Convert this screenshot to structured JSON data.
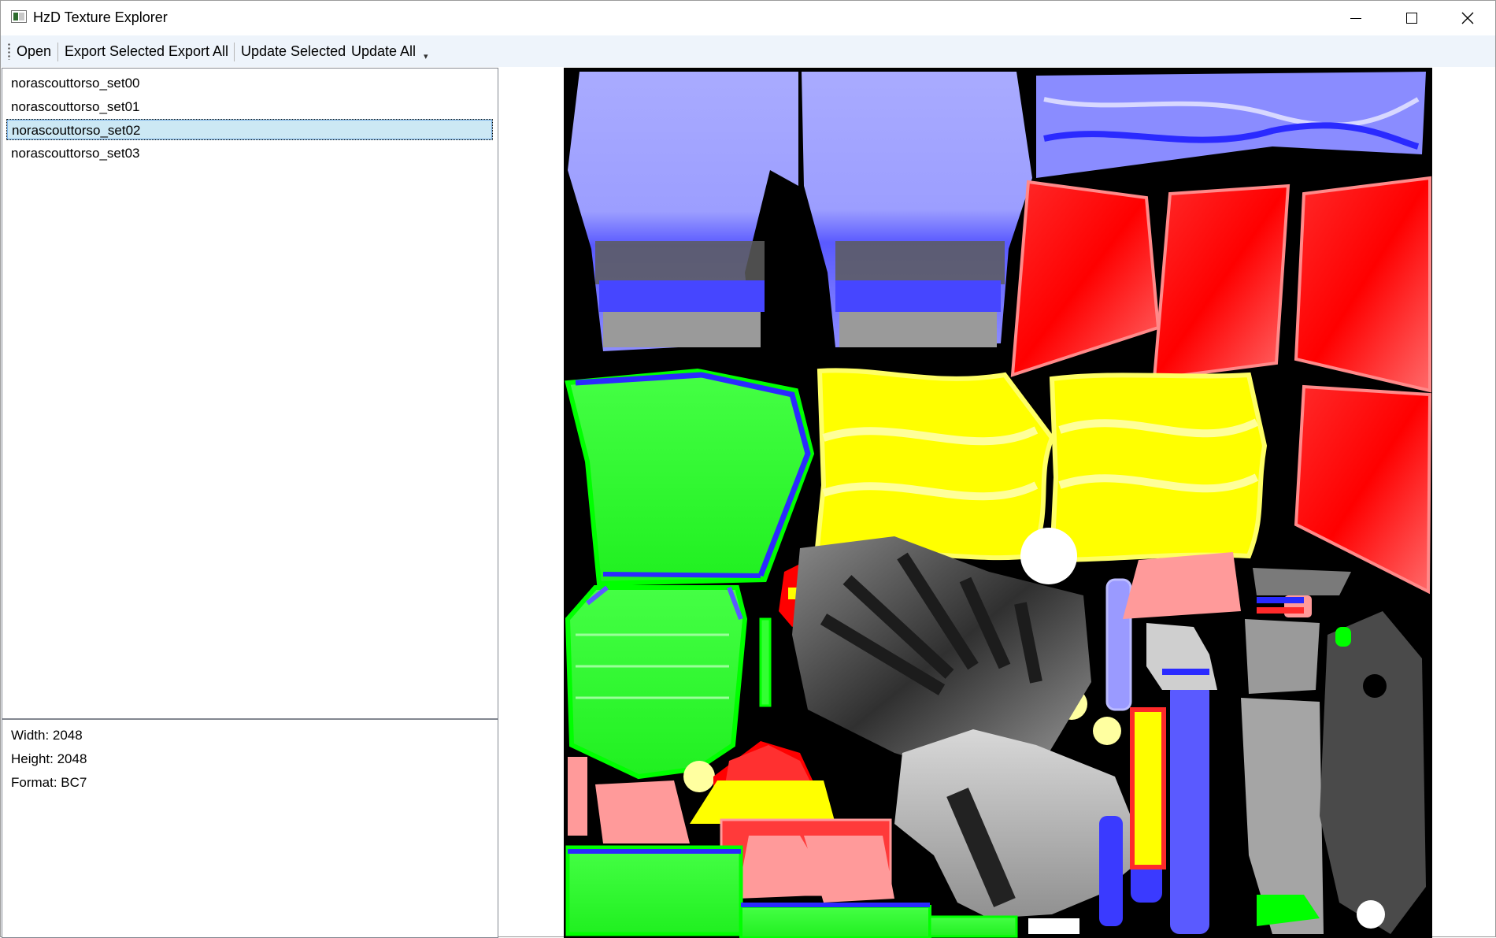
{
  "window": {
    "title": "HzD Texture Explorer"
  },
  "toolbar": {
    "open": "Open",
    "export_selected": "Export Selected",
    "export_all": "Export All",
    "update_selected": "Update Selected",
    "update_all": "Update All"
  },
  "list": {
    "items": [
      {
        "label": "norascouttorso_set00"
      },
      {
        "label": "norascouttorso_set01"
      },
      {
        "label": "norascouttorso_set02"
      },
      {
        "label": "norascouttorso_set03"
      }
    ],
    "selected_index": 2
  },
  "info": {
    "width": "Width: 2048",
    "height": "Height: 2048",
    "format": "Format: BC7"
  },
  "colors": {
    "toolbar_bg": "#eef4fb",
    "selection_bg": "#cce8f4",
    "texture_blue": "#9ea0ff",
    "texture_red": "#ff0000",
    "texture_green": "#00ff00",
    "texture_yellow": "#ffff00"
  },
  "icons": [
    "app-icon",
    "minimize-icon",
    "maximize-icon",
    "close-icon",
    "toolbar-grip-icon",
    "toolbar-overflow-icon"
  ]
}
